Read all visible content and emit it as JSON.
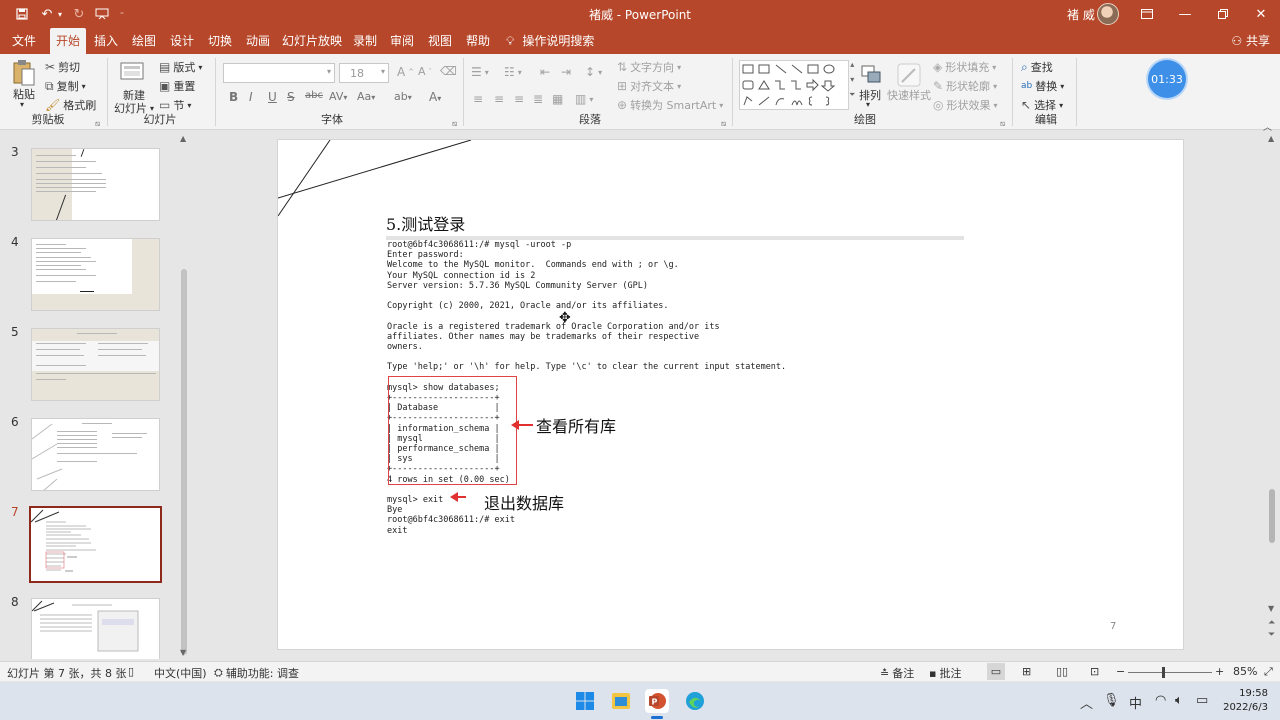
{
  "window": {
    "title": "褚威 - PowerPoint",
    "user_name": "褚 威"
  },
  "tabs": [
    "文件",
    "开始",
    "插入",
    "绘图",
    "设计",
    "切换",
    "动画",
    "幻灯片放映",
    "录制",
    "审阅",
    "视图",
    "帮助"
  ],
  "tell_me": "操作说明搜索",
  "share": "共享",
  "ribbon": {
    "clipboard": {
      "paste": "粘贴",
      "cut": "剪切",
      "copy": "复制",
      "format_painter": "格式刷",
      "label": "剪贴板"
    },
    "slides": {
      "new_slide_line1": "新建",
      "new_slide_line2": "幻灯片",
      "layout": "版式",
      "reset": "重置",
      "section": "节",
      "label": "幻灯片"
    },
    "font": {
      "size": "18",
      "label": "字体"
    },
    "paragraph": {
      "text_direction": "文字方向",
      "align_text": "对齐文本",
      "convert_smartart": "转换为 SmartArt",
      "label": "段落"
    },
    "drawing": {
      "arrange": "排列",
      "quick_styles": "快速样式",
      "shape_fill": "形状填充",
      "shape_outline": "形状轮廓",
      "shape_effects": "形状效果",
      "label": "绘图"
    },
    "editing": {
      "find": "查找",
      "replace": "替换",
      "select": "选择",
      "label": "编辑"
    }
  },
  "timer": "01:33",
  "thumbnails": [
    {
      "num": "3"
    },
    {
      "num": "4"
    },
    {
      "num": "5"
    },
    {
      "num": "6"
    },
    {
      "num": "7",
      "active": true
    },
    {
      "num": "8"
    }
  ],
  "slide": {
    "title": "5.测试登录",
    "terminal_lines": [
      "root@6bf4c3068611:/# mysql -uroot -p",
      "Enter password:",
      "Welcome to the MySQL monitor.  Commands end with ; or \\g.",
      "Your MySQL connection id is 2",
      "Server version: 5.7.36 MySQL Community Server (GPL)",
      "",
      "Copyright (c) 2000, 2021, Oracle and/or its affiliates.",
      "",
      "Oracle is a registered trademark of Oracle Corporation and/or its",
      "affiliates. Other names may be trademarks of their respective",
      "owners.",
      "",
      "Type 'help;' or '\\h' for help. Type '\\c' to clear the current input statement.",
      "",
      "mysql> show databases;",
      "+--------------------+",
      "| Database           |",
      "+--------------------+",
      "| information_schema |",
      "| mysql              |",
      "| performance_schema |",
      "| sys                |",
      "+--------------------+",
      "4 rows in set (0.00 sec)",
      "",
      "mysql> exit",
      "Bye",
      "root@6bf4c3068611:/# exit",
      "exit"
    ],
    "callout_databases": "查看所有库",
    "callout_exit": "退出数据库",
    "page_number": "7"
  },
  "status": {
    "slide_info": "幻灯片 第 7 张，共 8 张",
    "language": "中文(中国)",
    "accessibility": "辅助功能: 调查",
    "notes": "备注",
    "comments": "批注",
    "zoom": "85%"
  },
  "taskbar": {
    "time": "19:58",
    "date": "2022/6/3",
    "ime": "中"
  }
}
